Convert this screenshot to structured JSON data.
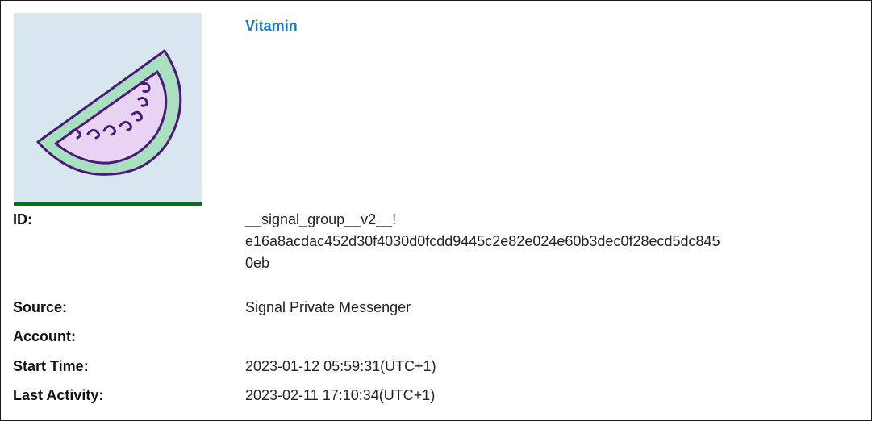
{
  "title": "Vitamin",
  "avatar_icon": "watermelon-slice-icon",
  "colors": {
    "title": "#1e7cc0",
    "avatar_bg": "#d8e6ef",
    "underline": "#00760a",
    "melon_flesh": "#e9d3f2",
    "melon_rind": "#a8e0c0",
    "melon_outline": "#4b1a78"
  },
  "details": {
    "id": {
      "label": "ID:",
      "value_lines": [
        "__signal_group__v2__!",
        "e16a8acdac452d30f4030d0fcdd9445c2e82e024e60b3dec0f28ecd5dc845",
        "0eb"
      ]
    },
    "source": {
      "label": "Source:",
      "value": "Signal Private Messenger"
    },
    "account": {
      "label": "Account:",
      "value": ""
    },
    "start_time": {
      "label": "Start Time:",
      "value": "2023-01-12 05:59:31(UTC+1)"
    },
    "last_activity": {
      "label": "Last Activity:",
      "value": "2023-02-11 17:10:34(UTC+1)"
    }
  }
}
